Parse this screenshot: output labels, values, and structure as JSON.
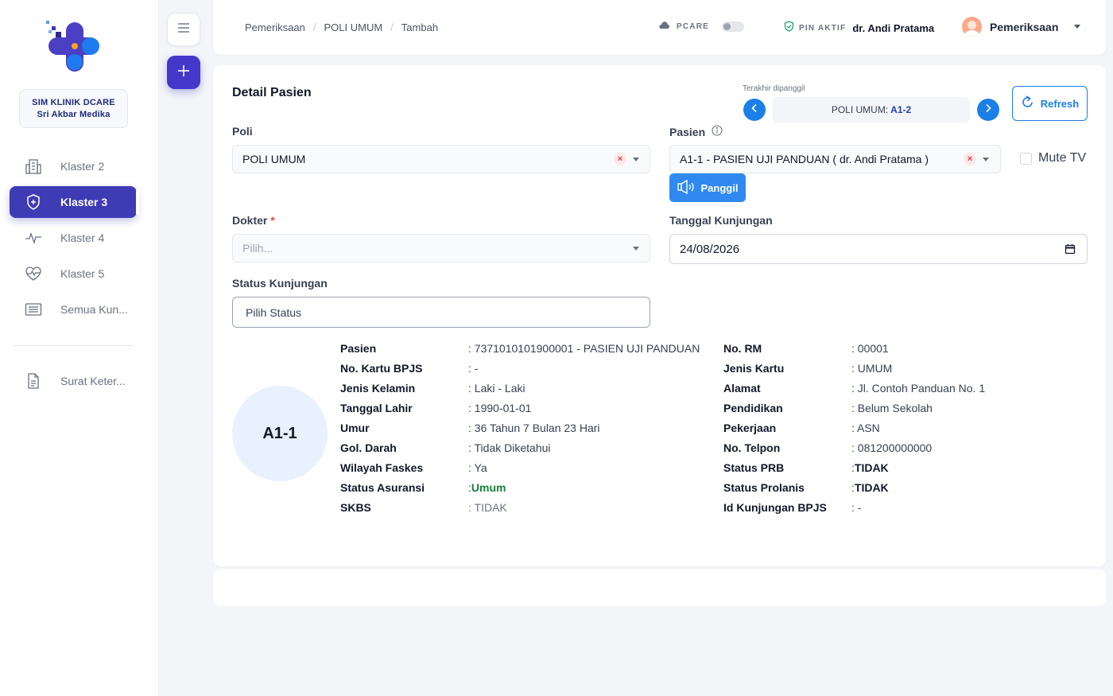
{
  "sidebar": {
    "clinic_line1": "SIM KLINIK DCARE",
    "clinic_line2": "Sri Akbar Medika",
    "items": [
      {
        "label": "Klaster 2",
        "icon": "building-icon"
      },
      {
        "label": "Klaster 3",
        "icon": "shield-icon",
        "active": true
      },
      {
        "label": "Klaster 4",
        "icon": "pulse-icon"
      },
      {
        "label": "Klaster 5",
        "icon": "heart-pulse-icon"
      },
      {
        "label": "Semua Kun...",
        "icon": "list-icon"
      },
      {
        "label": "Surat Keter...",
        "icon": "document-icon"
      }
    ]
  },
  "header": {
    "breadcrumb": [
      "Pemeriksaan",
      "POLI UMUM",
      "Tambah"
    ],
    "pcare_label": "PCARE",
    "pin_label": "PIN AKTIF",
    "doctor": "dr. Andi Pratama",
    "user_menu": "Pemeriksaan"
  },
  "form": {
    "title": "Detail Pasien",
    "last_called_label": "Terakhir dipanggil",
    "queue_prefix": "POLI UMUM:",
    "queue_number": "A1-2",
    "refresh_label": "Refresh",
    "poli_label": "Poli",
    "poli_value": "POLI UMUM",
    "pasien_label": "Pasien",
    "pasien_value": "A1-1 - PASIEN UJI PANDUAN ( dr. Andi Pratama )",
    "mute_label": "Mute TV",
    "panggil_label": "Panggil",
    "dokter_label": "Dokter",
    "dokter_placeholder": "Pilih...",
    "tanggal_label": "Tanggal Kunjungan",
    "tanggal_value": "24/08/2026",
    "status_label": "Status Kunjungan",
    "status_placeholder": "Pilih Status"
  },
  "patient": {
    "queue": "A1-1",
    "left": [
      {
        "k": "Pasien",
        "v": ": 7371010101900001 - PASIEN UJI PANDUAN"
      },
      {
        "k": "No. Kartu BPJS",
        "v": ": -"
      },
      {
        "k": "Jenis Kelamin",
        "v": ": Laki - Laki"
      },
      {
        "k": "Tanggal Lahir",
        "v": ": 1990-01-01"
      },
      {
        "k": "Umur",
        "v": ": 36 Tahun 7 Bulan 23 Hari"
      },
      {
        "k": "Gol. Darah",
        "v": ": Tidak Diketahui"
      },
      {
        "k": "Wilayah Faskes",
        "v": ": Ya"
      },
      {
        "k": "Status Asuransi",
        "v": ": ",
        "v2": "Umum"
      },
      {
        "k": "SKBS",
        "v": ": TIDAK"
      }
    ],
    "right": [
      {
        "k": "No. RM",
        "v": ": 00001"
      },
      {
        "k": "Jenis Kartu",
        "v": ": UMUM"
      },
      {
        "k": "Alamat",
        "v": ": Jl. Contoh Panduan No. 1"
      },
      {
        "k": "Pendidikan",
        "v": ": Belum Sekolah"
      },
      {
        "k": "Pekerjaan",
        "v": ": ASN"
      },
      {
        "k": "No. Telpon",
        "v": ": 081200000000"
      },
      {
        "k": "Status PRB",
        "v": ": ",
        "v2": "TIDAK"
      },
      {
        "k": "Status Prolanis",
        "v": ": ",
        "v2": "TIDAK"
      },
      {
        "k": "Id Kunjungan BPJS",
        "v": ": -"
      }
    ]
  },
  "colors": {
    "primary": "#3f3bb5",
    "accent_blue": "#1a7fe6",
    "success": "#15803d"
  }
}
